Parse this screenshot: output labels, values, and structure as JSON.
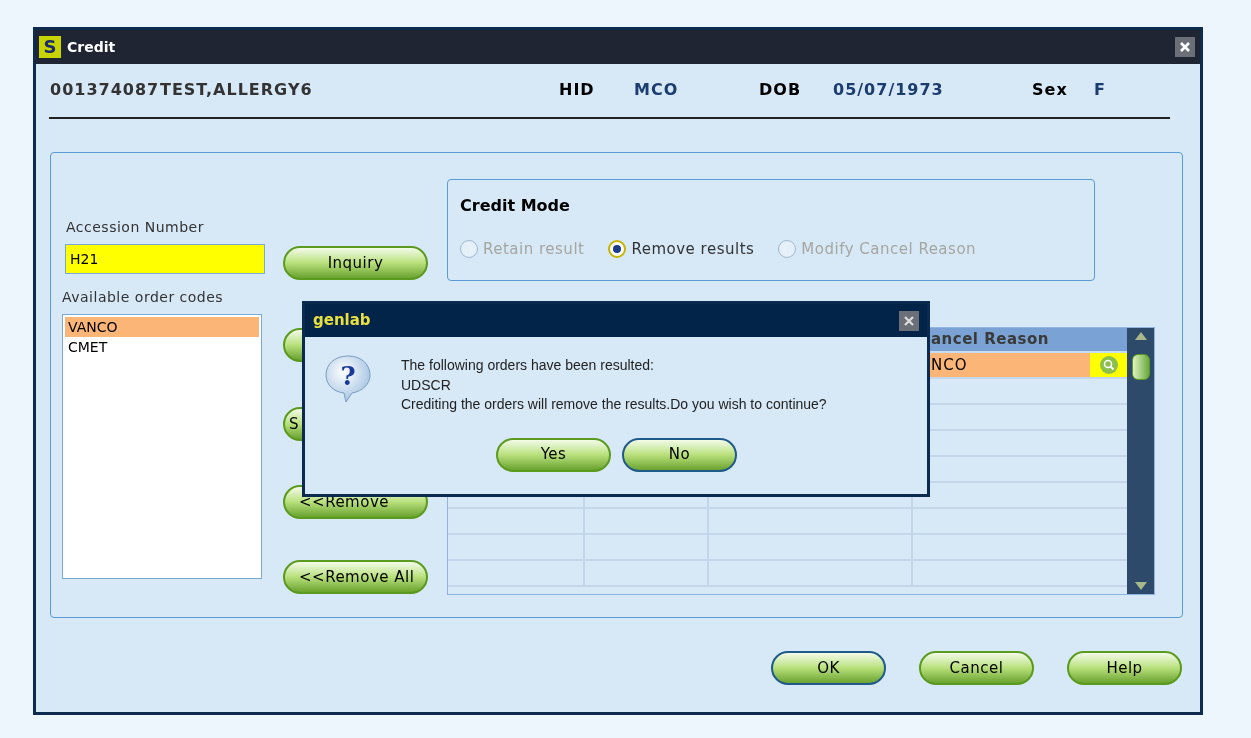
{
  "window": {
    "title": "Credit",
    "app_icon": "S"
  },
  "patient": {
    "mrn": "001374087",
    "name": "TEST,ALLERGY6",
    "fields": [
      {
        "label": "HID",
        "value": "MCO"
      },
      {
        "label": "DOB",
        "value": "05/07/1973"
      },
      {
        "label": "Sex",
        "value": "F"
      }
    ]
  },
  "accession": {
    "label": "Accession Number",
    "value": "H21"
  },
  "order_codes": {
    "label": "Available order codes",
    "items": [
      {
        "text": "VANCO",
        "selected": true
      },
      {
        "text": "CMET",
        "selected": false
      }
    ]
  },
  "side_buttons": [
    {
      "label": "Inquiry",
      "kind": "button"
    },
    {
      "kind": "covered"
    },
    {
      "label": "S",
      "kind": "button"
    },
    {
      "label": "<<Remove",
      "kind": "button"
    },
    {
      "label": "<<Remove All",
      "kind": "button"
    }
  ],
  "credit_mode": {
    "title": "Credit Mode",
    "options": [
      {
        "label": "Retain result",
        "selected": false,
        "disabled": true
      },
      {
        "label": "Remove results",
        "selected": true,
        "disabled": false
      },
      {
        "label": "Modify Cancel Reason",
        "selected": false,
        "disabled": true
      }
    ]
  },
  "table": {
    "column_4": "ancel Reason",
    "rows": [
      {
        "column_4": "NCO",
        "selected": true
      }
    ]
  },
  "dialog": {
    "title": "genlab",
    "icon_glyph": "?",
    "lines": [
      "The following orders have been resulted:",
      "UDSCR",
      "Crediting the orders will remove the results.Do you wish to continue?"
    ],
    "buttons": [
      {
        "label": "Yes",
        "focused": false
      },
      {
        "label": "No",
        "focused": true
      }
    ]
  },
  "buttons": [
    {
      "label": "OK",
      "focused": true
    },
    {
      "label": "Cancel",
      "focused": false
    },
    {
      "label": "Help",
      "focused": false
    }
  ]
}
